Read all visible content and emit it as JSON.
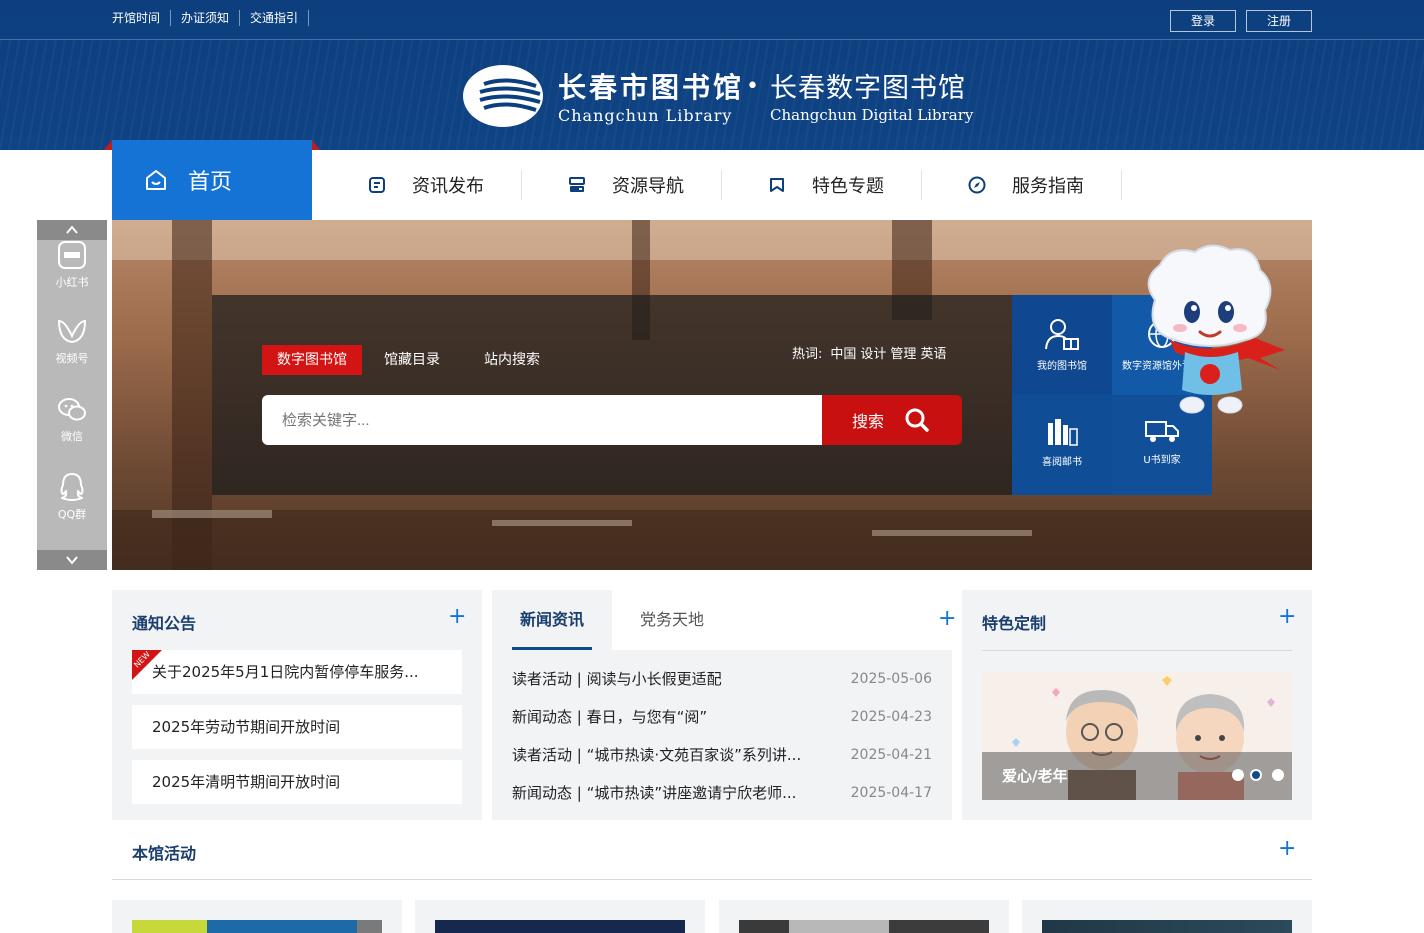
{
  "topbar": {
    "links": [
      "开馆时间",
      "办证须知",
      "交通指引"
    ],
    "login": "登录",
    "register": "注册"
  },
  "logo": {
    "cn_name": "长春市图书馆",
    "en_name": "Changchun Library",
    "separator": "•",
    "digital_cn": "长春数字图书馆",
    "digital_en": "Changchun Digital Library"
  },
  "nav": {
    "home": "首页",
    "items": [
      {
        "label": "资讯发布",
        "icon": "document-icon"
      },
      {
        "label": "资源导航",
        "icon": "server-icon"
      },
      {
        "label": "特色专题",
        "icon": "bookmark-icon"
      },
      {
        "label": "服务指南",
        "icon": "compass-icon"
      }
    ]
  },
  "sidebar": {
    "items": [
      {
        "label": "小红书",
        "icon": "xiaohongshu-icon"
      },
      {
        "label": "视频号",
        "icon": "video-channel-icon"
      },
      {
        "label": "微信",
        "icon": "wechat-icon"
      },
      {
        "label": "QQ群",
        "icon": "qq-icon"
      }
    ]
  },
  "search": {
    "tabs": [
      "数字图书馆",
      "馆藏目录",
      "站内搜索"
    ],
    "active_tab": "数字图书馆",
    "hot_label": "热词:",
    "hot_words": [
      "中国",
      "设计",
      "管理",
      "英语"
    ],
    "placeholder": "检索关键字...",
    "button": "搜索"
  },
  "quick_links": [
    {
      "label": "我的图书馆",
      "icon": "reader-icon"
    },
    {
      "label": "数字资源馆外访问",
      "icon": "globe-icon"
    },
    {
      "label": "喜阅邮书",
      "icon": "building-icon"
    },
    {
      "label": "U书到家",
      "icon": "truck-icon"
    }
  ],
  "notice": {
    "title": "通知公告",
    "new_badge": "NEW",
    "items": [
      "关于2025年5月1日院内暂停停车服务...",
      "2025年劳动节期间开放时间",
      "2025年清明节期间开放时间"
    ]
  },
  "news": {
    "tabs": [
      "新闻资讯",
      "党务天地"
    ],
    "items": [
      {
        "title": "读者活动 | 阅读与小长假更适配",
        "date": "2025-05-06"
      },
      {
        "title": "新闻动态 | 春日，与您有“阅”",
        "date": "2025-04-23"
      },
      {
        "title": "读者活动 | “城市热读·文苑百家谈”系列讲...",
        "date": "2025-04-21"
      },
      {
        "title": "新闻动态 | “城市热读”讲座邀请宁欣老师...",
        "date": "2025-04-17"
      }
    ]
  },
  "special": {
    "title": "特色定制",
    "caption": "爱心/老年",
    "slide_count": 3,
    "active_slide": 2
  },
  "activities": {
    "title": "本馆活动"
  },
  "colors": {
    "brand_blue": "#0d3f7e",
    "accent_blue": "#1573d6",
    "red": "#d21414"
  }
}
